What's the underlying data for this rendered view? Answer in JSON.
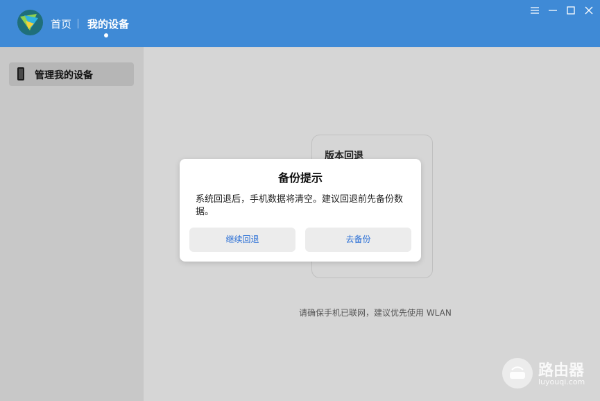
{
  "header": {
    "nav_home": "首页",
    "nav_devices": "我的设备",
    "accent_color": "#3f8ad6"
  },
  "window_controls": {
    "icons": [
      "menu-icon",
      "minimize-icon",
      "maximize-icon",
      "close-icon"
    ]
  },
  "sidebar": {
    "items": [
      {
        "label": "管理我的设备",
        "icon": "phone-icon",
        "selected": true
      }
    ]
  },
  "main": {
    "card_title": "版本回退",
    "hint": "请确保手机已联网，建议优先使用 WLAN"
  },
  "dialog": {
    "title": "备份提示",
    "message": "系统回退后，手机数据将清空。建议回退前先备份数据。",
    "continue_label": "继续回退",
    "backup_label": "去备份"
  },
  "watermark": {
    "name": "路由器",
    "url": "luyouqi.com"
  }
}
